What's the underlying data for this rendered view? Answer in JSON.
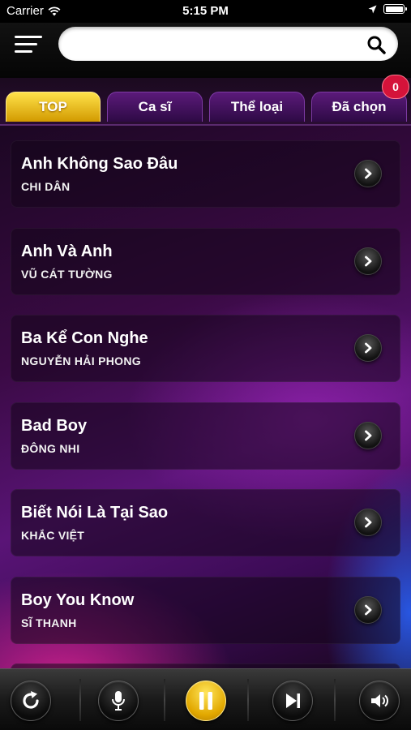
{
  "status_bar": {
    "carrier": "Carrier",
    "time": "5:15 PM"
  },
  "search": {
    "placeholder": "",
    "value": ""
  },
  "tabs": [
    {
      "label": "TOP",
      "active": true
    },
    {
      "label": "Ca sĩ",
      "active": false
    },
    {
      "label": "Thể loại",
      "active": false
    },
    {
      "label": "Đã chọn",
      "active": false
    }
  ],
  "selected_count": "0",
  "songs": [
    {
      "title": "Anh Không Sao Đâu",
      "artist": "CHI DÂN"
    },
    {
      "title": "Anh Và Anh",
      "artist": "VŨ CÁT TƯỜNG"
    },
    {
      "title": "Ba Kể Con Nghe",
      "artist": "NGUYỄN HẢI PHONG"
    },
    {
      "title": "Bad Boy",
      "artist": "ĐÔNG NHI"
    },
    {
      "title": "Biết Nói Là Tại Sao",
      "artist": "KHẮC VIỆT"
    },
    {
      "title": "Boy You Know",
      "artist": "SĨ THANH"
    }
  ],
  "controls": [
    {
      "icon": "replay-icon"
    },
    {
      "icon": "microphone-icon"
    },
    {
      "icon": "pause-icon"
    },
    {
      "icon": "skip-next-icon"
    },
    {
      "icon": "volume-icon"
    }
  ],
  "colors": {
    "accent": "#f2c200",
    "badge": "#d4133a",
    "tab": "#4a1466"
  }
}
